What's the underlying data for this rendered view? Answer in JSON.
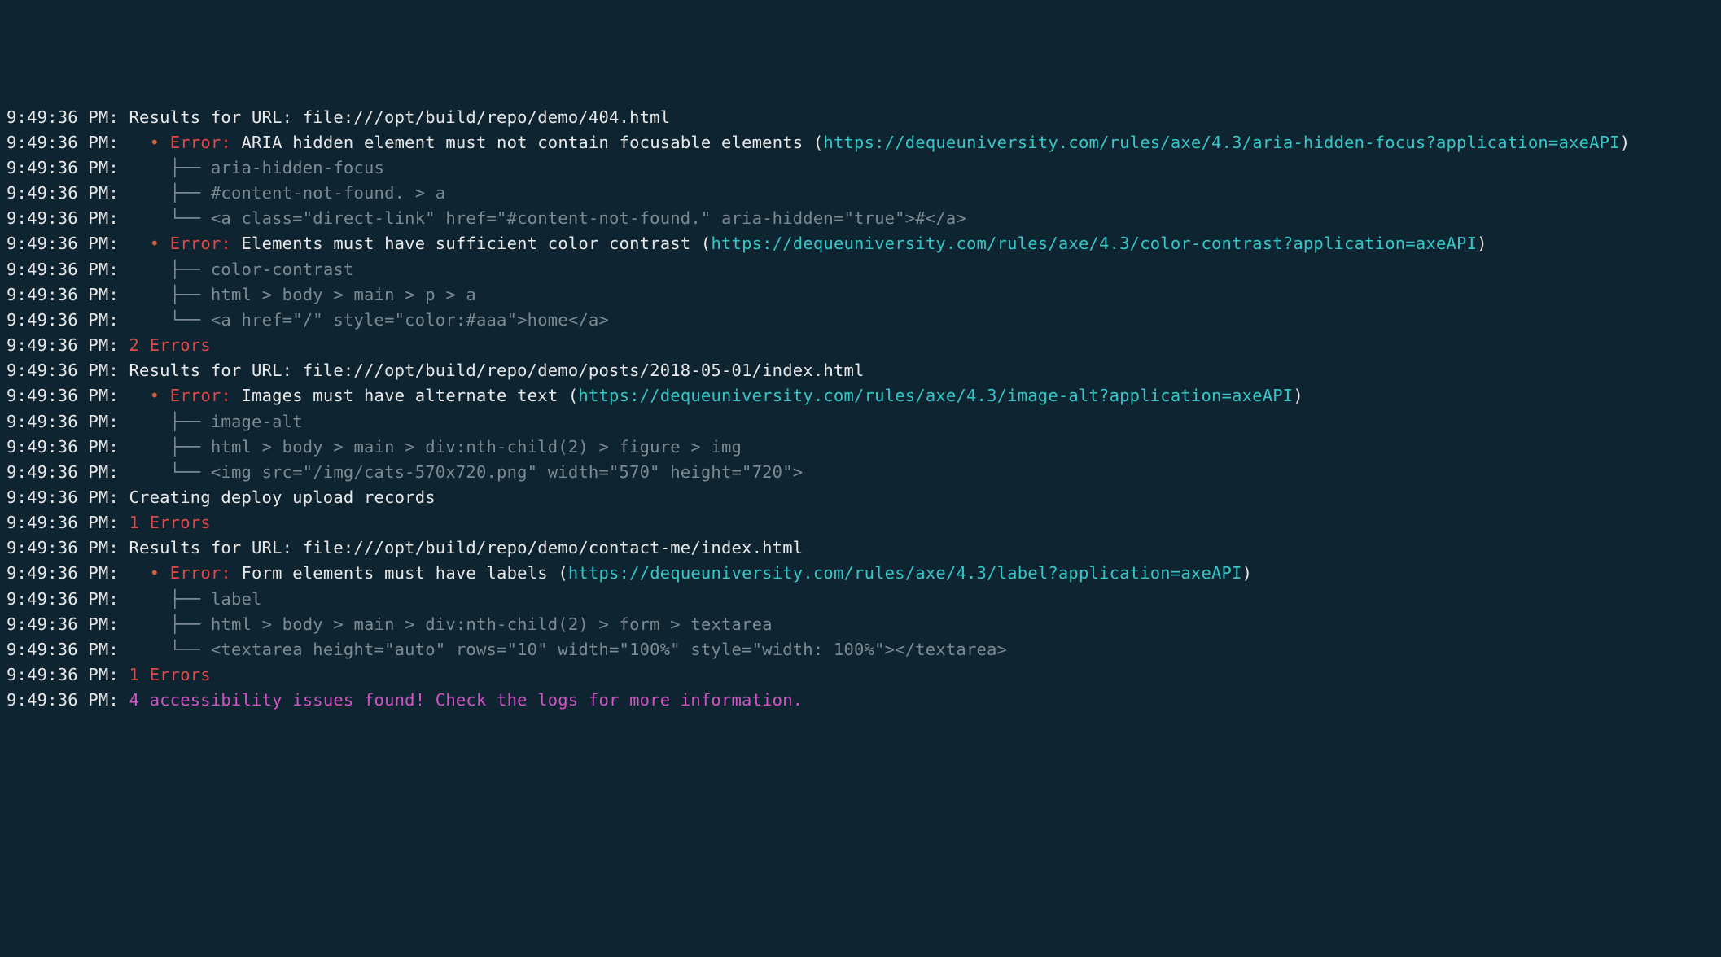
{
  "logs": [
    {
      "ts": "9:49:36 PM:",
      "segments": [
        {
          "t": " Results for URL: file:///opt/build/repo/demo/404.html",
          "c": "msg"
        }
      ]
    },
    {
      "ts": "9:49:36 PM:",
      "segments": [
        {
          "t": "   ",
          "c": "msg"
        },
        {
          "t": "•",
          "c": "bullet"
        },
        {
          "t": " ",
          "c": "msg"
        },
        {
          "t": "Error:",
          "c": "red"
        },
        {
          "t": " ARIA hidden element must not contain focusable elements (",
          "c": "msg"
        },
        {
          "t": "https://dequeuniversity.com/rules/axe/4.3/aria-hidden-focus?application=axeAPI",
          "c": "cyan",
          "link": true
        },
        {
          "t": ")",
          "c": "msg"
        }
      ]
    },
    {
      "ts": "9:49:36 PM:",
      "segments": [
        {
          "t": "     ├── ",
          "c": "tree"
        },
        {
          "t": "aria-hidden-focus",
          "c": "dim"
        }
      ]
    },
    {
      "ts": "9:49:36 PM:",
      "segments": [
        {
          "t": "     ├── ",
          "c": "tree"
        },
        {
          "t": "#content-not-found. > a",
          "c": "dim"
        }
      ]
    },
    {
      "ts": "9:49:36 PM:",
      "segments": [
        {
          "t": "     └── ",
          "c": "tree"
        },
        {
          "t": "<a class=\"direct-link\" href=\"#content-not-found.\" aria-hidden=\"true\">#</a>",
          "c": "dim"
        }
      ]
    },
    {
      "ts": "9:49:36 PM:",
      "segments": [
        {
          "t": "   ",
          "c": "msg"
        },
        {
          "t": "•",
          "c": "bullet"
        },
        {
          "t": " ",
          "c": "msg"
        },
        {
          "t": "Error:",
          "c": "red"
        },
        {
          "t": " Elements must have sufficient color contrast (",
          "c": "msg"
        },
        {
          "t": "https://dequeuniversity.com/rules/axe/4.3/color-contrast?application=axeAPI",
          "c": "cyan",
          "link": true
        },
        {
          "t": ")",
          "c": "msg"
        }
      ]
    },
    {
      "ts": "9:49:36 PM:",
      "segments": [
        {
          "t": "     ├── ",
          "c": "tree"
        },
        {
          "t": "color-contrast",
          "c": "dim"
        }
      ]
    },
    {
      "ts": "9:49:36 PM:",
      "segments": [
        {
          "t": "     ├── ",
          "c": "tree"
        },
        {
          "t": "html > body > main > p > a",
          "c": "dim"
        }
      ]
    },
    {
      "ts": "9:49:36 PM:",
      "segments": [
        {
          "t": "     └── ",
          "c": "tree"
        },
        {
          "t": "<a href=\"/\" style=\"color:#aaa\">home</a>",
          "c": "dim"
        }
      ]
    },
    {
      "ts": "9:49:36 PM:",
      "segments": [
        {
          "t": " ",
          "c": "msg"
        },
        {
          "t": "2 Errors",
          "c": "red"
        }
      ]
    },
    {
      "ts": "9:49:36 PM:",
      "segments": [
        {
          "t": " Results for URL: file:///opt/build/repo/demo/posts/2018-05-01/index.html",
          "c": "msg"
        }
      ]
    },
    {
      "ts": "9:49:36 PM:",
      "segments": [
        {
          "t": "   ",
          "c": "msg"
        },
        {
          "t": "•",
          "c": "bullet"
        },
        {
          "t": " ",
          "c": "msg"
        },
        {
          "t": "Error:",
          "c": "red"
        },
        {
          "t": " Images must have alternate text (",
          "c": "msg"
        },
        {
          "t": "https://dequeuniversity.com/rules/axe/4.3/image-alt?application=axeAPI",
          "c": "cyan",
          "link": true
        },
        {
          "t": ")",
          "c": "msg"
        }
      ]
    },
    {
      "ts": "9:49:36 PM:",
      "segments": [
        {
          "t": "     ├── ",
          "c": "tree"
        },
        {
          "t": "image-alt",
          "c": "dim"
        }
      ]
    },
    {
      "ts": "9:49:36 PM:",
      "segments": [
        {
          "t": "     ├── ",
          "c": "tree"
        },
        {
          "t": "html > body > main > div:nth-child(2) > figure > img",
          "c": "dim"
        }
      ]
    },
    {
      "ts": "9:49:36 PM:",
      "segments": [
        {
          "t": "     └── ",
          "c": "tree"
        },
        {
          "t": "<img src=\"/img/cats-570x720.png\" width=\"570\" height=\"720\">",
          "c": "dim"
        }
      ]
    },
    {
      "ts": "9:49:36 PM:",
      "segments": [
        {
          "t": " Creating deploy upload records",
          "c": "msg"
        }
      ]
    },
    {
      "ts": "9:49:36 PM:",
      "segments": [
        {
          "t": " ",
          "c": "msg"
        },
        {
          "t": "1 Errors",
          "c": "red"
        }
      ]
    },
    {
      "ts": "9:49:36 PM:",
      "segments": [
        {
          "t": " Results for URL: file:///opt/build/repo/demo/contact-me/index.html",
          "c": "msg"
        }
      ]
    },
    {
      "ts": "9:49:36 PM:",
      "segments": [
        {
          "t": "   ",
          "c": "msg"
        },
        {
          "t": "•",
          "c": "bullet"
        },
        {
          "t": " ",
          "c": "msg"
        },
        {
          "t": "Error:",
          "c": "red"
        },
        {
          "t": " Form elements must have labels (",
          "c": "msg"
        },
        {
          "t": "https://dequeuniversity.com/rules/axe/4.3/label?application=axeAPI",
          "c": "cyan",
          "link": true
        },
        {
          "t": ")",
          "c": "msg"
        }
      ]
    },
    {
      "ts": "9:49:36 PM:",
      "segments": [
        {
          "t": "     ├── ",
          "c": "tree"
        },
        {
          "t": "label",
          "c": "dim"
        }
      ]
    },
    {
      "ts": "9:49:36 PM:",
      "segments": [
        {
          "t": "     ├── ",
          "c": "tree"
        },
        {
          "t": "html > body > main > div:nth-child(2) > form > textarea",
          "c": "dim"
        }
      ]
    },
    {
      "ts": "9:49:36 PM:",
      "segments": [
        {
          "t": "     └── ",
          "c": "tree"
        },
        {
          "t": "<textarea height=\"auto\" rows=\"10\" width=\"100%\" style=\"width: 100%\"></textarea>",
          "c": "dim"
        }
      ]
    },
    {
      "ts": "9:49:36 PM:",
      "segments": [
        {
          "t": " ",
          "c": "msg"
        },
        {
          "t": "1 Errors",
          "c": "red"
        }
      ]
    },
    {
      "ts": "9:49:36 PM:",
      "segments": [
        {
          "t": " ",
          "c": "msg"
        },
        {
          "t": "4 accessibility issues found! Check the logs for more information.",
          "c": "pink"
        }
      ]
    }
  ]
}
